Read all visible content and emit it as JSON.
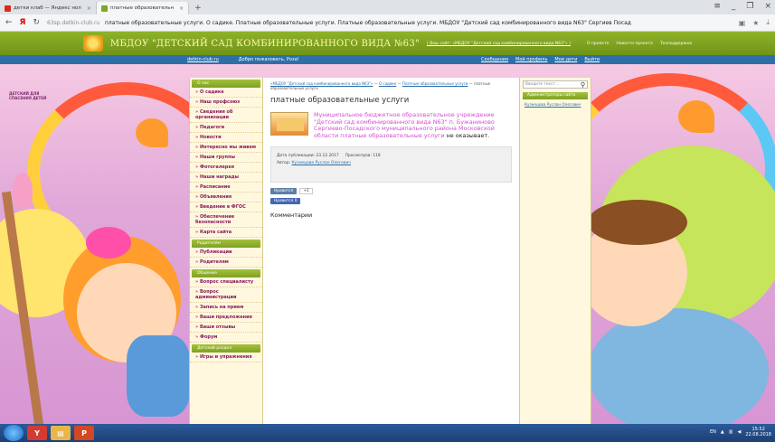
{
  "browser": {
    "tabs": [
      {
        "label": "детки клаб — Яндекс нол",
        "color": "#e1261c"
      },
      {
        "label": "платные образовательн",
        "color": "#7ba828"
      }
    ],
    "address": {
      "domain": "63sp.detkin-club.ru",
      "title": "платные образовательные услуги. О садике. Платные образовательные услуги. Платные образовательные услуги. МБДОУ \"Детский сад комбинированного вида N63\" Сергиев Посад"
    }
  },
  "site": {
    "title": "МБДОУ \"ДЕТСКИЙ САД КОМБИНИРОВАННОГО ВИДА №63\"",
    "subtitle": "( Ваш сайт: «МБДОУ \"Детский сад комбинированного вида N63\"» )",
    "top_links": [
      "О проекте",
      "Новости проекта",
      "Техподдержка"
    ],
    "userbar": {
      "site_link": "detkin-club.ru",
      "greeting": "Добро пожаловать, Роза!",
      "links": [
        "Сообщения",
        "Мой профиль",
        "Мои дети",
        "Выйти"
      ]
    },
    "bg_logo": "ДЕТСКИЙ ДЛЯ СПАСЕНИЯ ДЕТЕЙ"
  },
  "sidebar": {
    "sections": [
      {
        "title": "О нас",
        "items": [
          "О садике",
          "Наш профсоюз",
          "Сведения об организации",
          "Педагоги",
          "Новости",
          "Интересно мы живем",
          "Наши группы",
          "Фотогалерея",
          "Наши награды",
          "Расписание",
          "Объявления",
          "Введение в ФГОС",
          "Обеспечение безопасности",
          "Карта сайта"
        ]
      },
      {
        "title": "Родителям",
        "items": [
          "Публикации",
          "Родителям"
        ]
      },
      {
        "title": "Общение",
        "items": [
          "Вопрос специалисту",
          "Вопрос администрации",
          "Запись на прием",
          "Ваши предложения",
          "Ваши отзывы",
          "Форум"
        ]
      },
      {
        "title": "Детский раздел",
        "items": [
          "Игры и упражнения"
        ]
      }
    ]
  },
  "content": {
    "breadcrumbs": [
      "«МБДОУ \"Детский сад комбинированного вида N63\"»",
      "О садике",
      "Платные образовательные услуги",
      "платные образовательные услуги"
    ],
    "page_title": "платные образовательные услуги",
    "post_text": "Муниципальное бюджетное образовательное учреждение \"Детский сад комбинированного вида N63\" п. Бужаниново Сергиево-Посадского муниципального района Московской области платные образовательные услуги",
    "post_text_end": " не оказывает.",
    "pub_date_label": "Дата публикации: 23.12.2017",
    "views_label": "Просмотров: 118",
    "author_label": "Автор:",
    "author": "Кузнецова Руслан Олегович",
    "vk_label": "Нравится",
    "vk_count": "+1",
    "fb_label": "Нравится 0",
    "comments_title": "Комментарии"
  },
  "right": {
    "search_placeholder": "Введите текст...",
    "admin_title": "Администраторы сайта",
    "admin_name": "Кузнецова Руслан Олегович"
  },
  "taskbar": {
    "lang": "EN",
    "time": "15:52",
    "date": "22.08.2018"
  }
}
